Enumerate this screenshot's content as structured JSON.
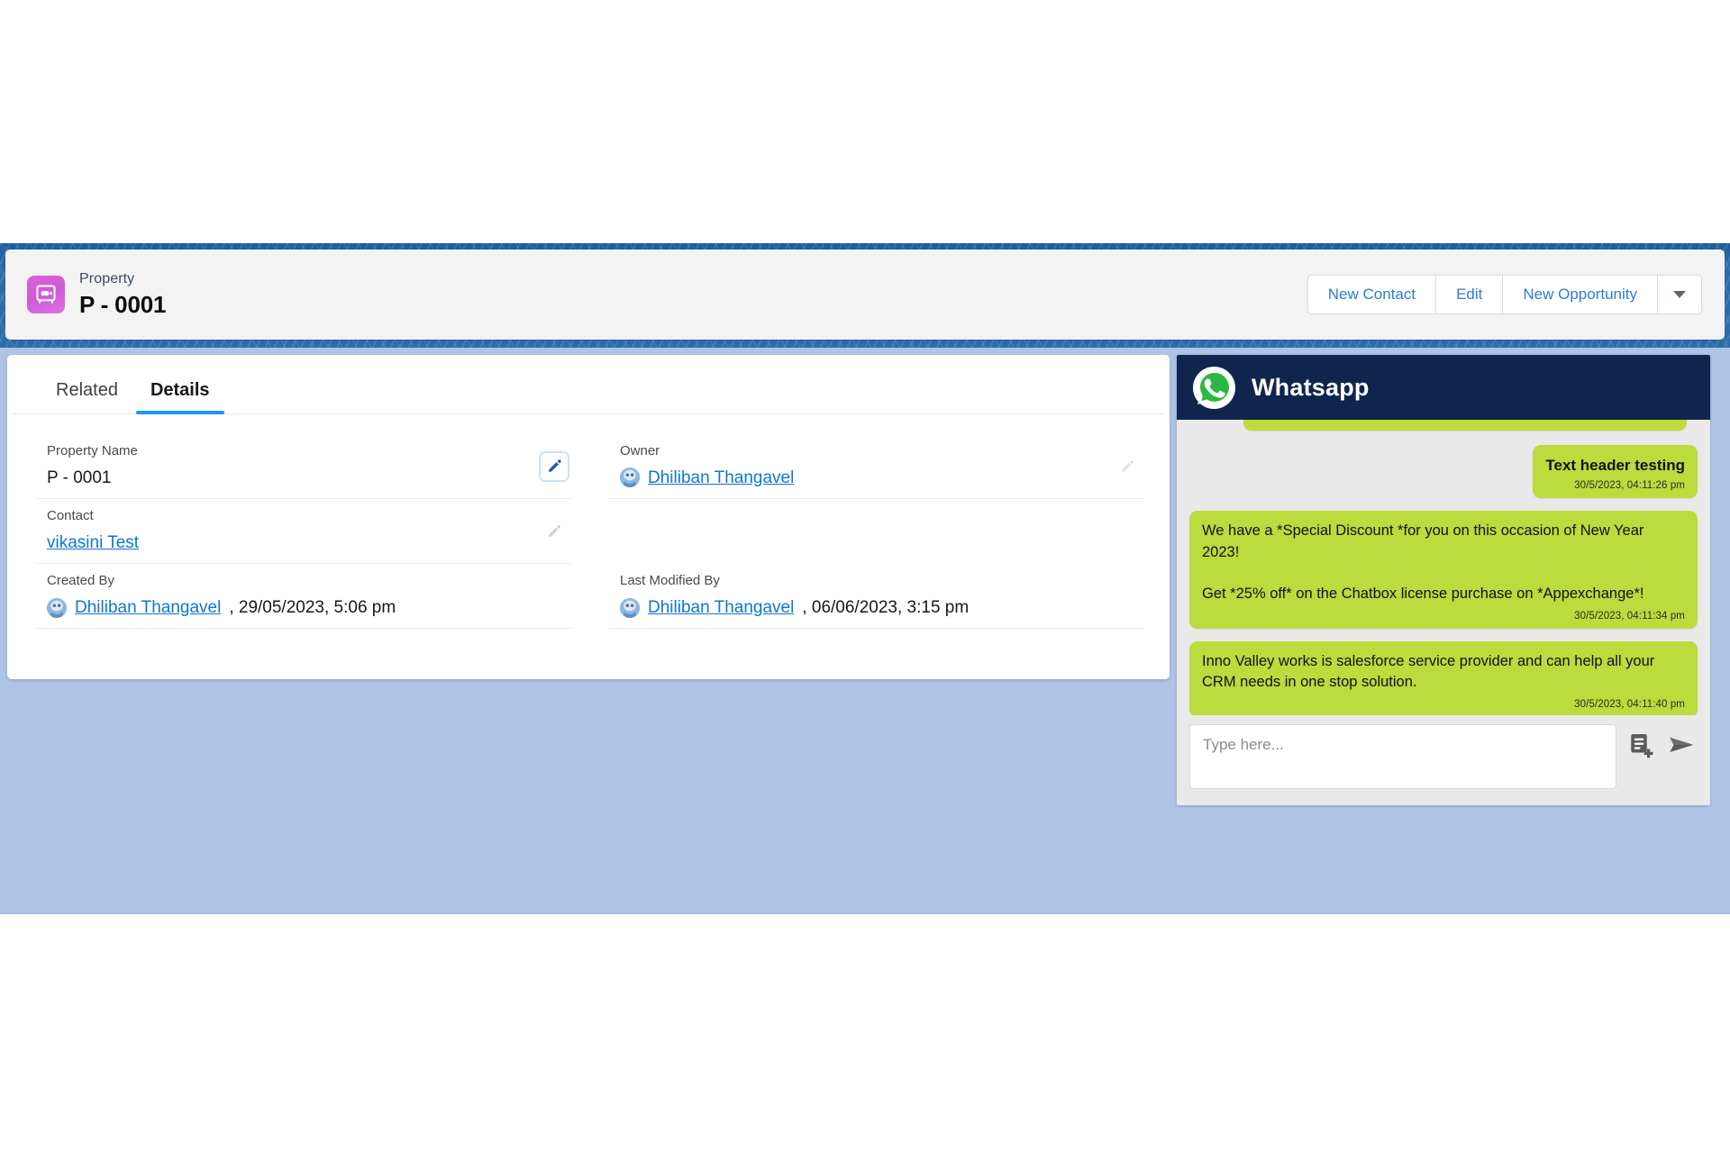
{
  "record_header": {
    "icon": "property-vault-icon",
    "object_type": "Property",
    "record_name": "P - 0001",
    "actions": [
      {
        "label": "New Contact",
        "name": "new-contact-button"
      },
      {
        "label": "Edit",
        "name": "edit-button"
      },
      {
        "label": "New Opportunity",
        "name": "new-opportunity-button"
      }
    ],
    "more_actions_icon": "chevron-down-icon"
  },
  "details_card": {
    "tabs": [
      {
        "label": "Related",
        "active": false
      },
      {
        "label": "Details",
        "active": true
      }
    ],
    "fields": {
      "property_name": {
        "label": "Property Name",
        "value": "P - 0001",
        "edit_icon": "pencil-icon"
      },
      "owner": {
        "label": "Owner",
        "value": "Dhiliban Thangavel",
        "edit_icon": "pencil-icon"
      },
      "contact": {
        "label": "Contact",
        "value": "vikasini Test",
        "edit_icon": "pencil-icon"
      },
      "created_by": {
        "label": "Created By",
        "user": "Dhiliban Thangavel",
        "timestamp": ", 29/05/2023, 5:06 pm"
      },
      "last_modified_by": {
        "label": "Last Modified By",
        "user": "Dhiliban Thangavel",
        "timestamp": ", 06/06/2023, 3:15 pm"
      }
    }
  },
  "whatsapp": {
    "logo_icon": "whatsapp-icon",
    "title": "Whatsapp",
    "messages": [
      {
        "id": "clipped",
        "text": "",
        "time": "",
        "align": "left",
        "clipped": true
      },
      {
        "id": "m1",
        "text": "Text header testing",
        "time": "30/5/2023, 04:11:26 pm",
        "align": "right",
        "clipped": false
      },
      {
        "id": "m2",
        "text": "We have a *Special Discount *for you on this occasion of New Year 2023!\n\nGet *25% off* on the Chatbox license purchase on *Appexchange*!",
        "time": "30/5/2023, 04:11:34 pm",
        "align": "left",
        "clipped": false
      },
      {
        "id": "m3",
        "text": "Inno Valley works is salesforce service provider and can help all your CRM needs in one stop solution.",
        "time": "30/5/2023, 04:11:40 pm",
        "align": "left",
        "clipped": false
      }
    ],
    "composer": {
      "placeholder": "Type here...",
      "value": "",
      "template_icon": "add-template-icon",
      "send_icon": "send-icon"
    }
  },
  "colors": {
    "brand_blue": "#1b5d9e",
    "canvas_blue": "#aec4e6",
    "link_blue": "#0f76d1",
    "whatsapp_header": "#10254d",
    "bubble_green": "#bcdb3c",
    "record_icon_pink": "#d664dd",
    "tab_underline": "#1b96ff"
  }
}
